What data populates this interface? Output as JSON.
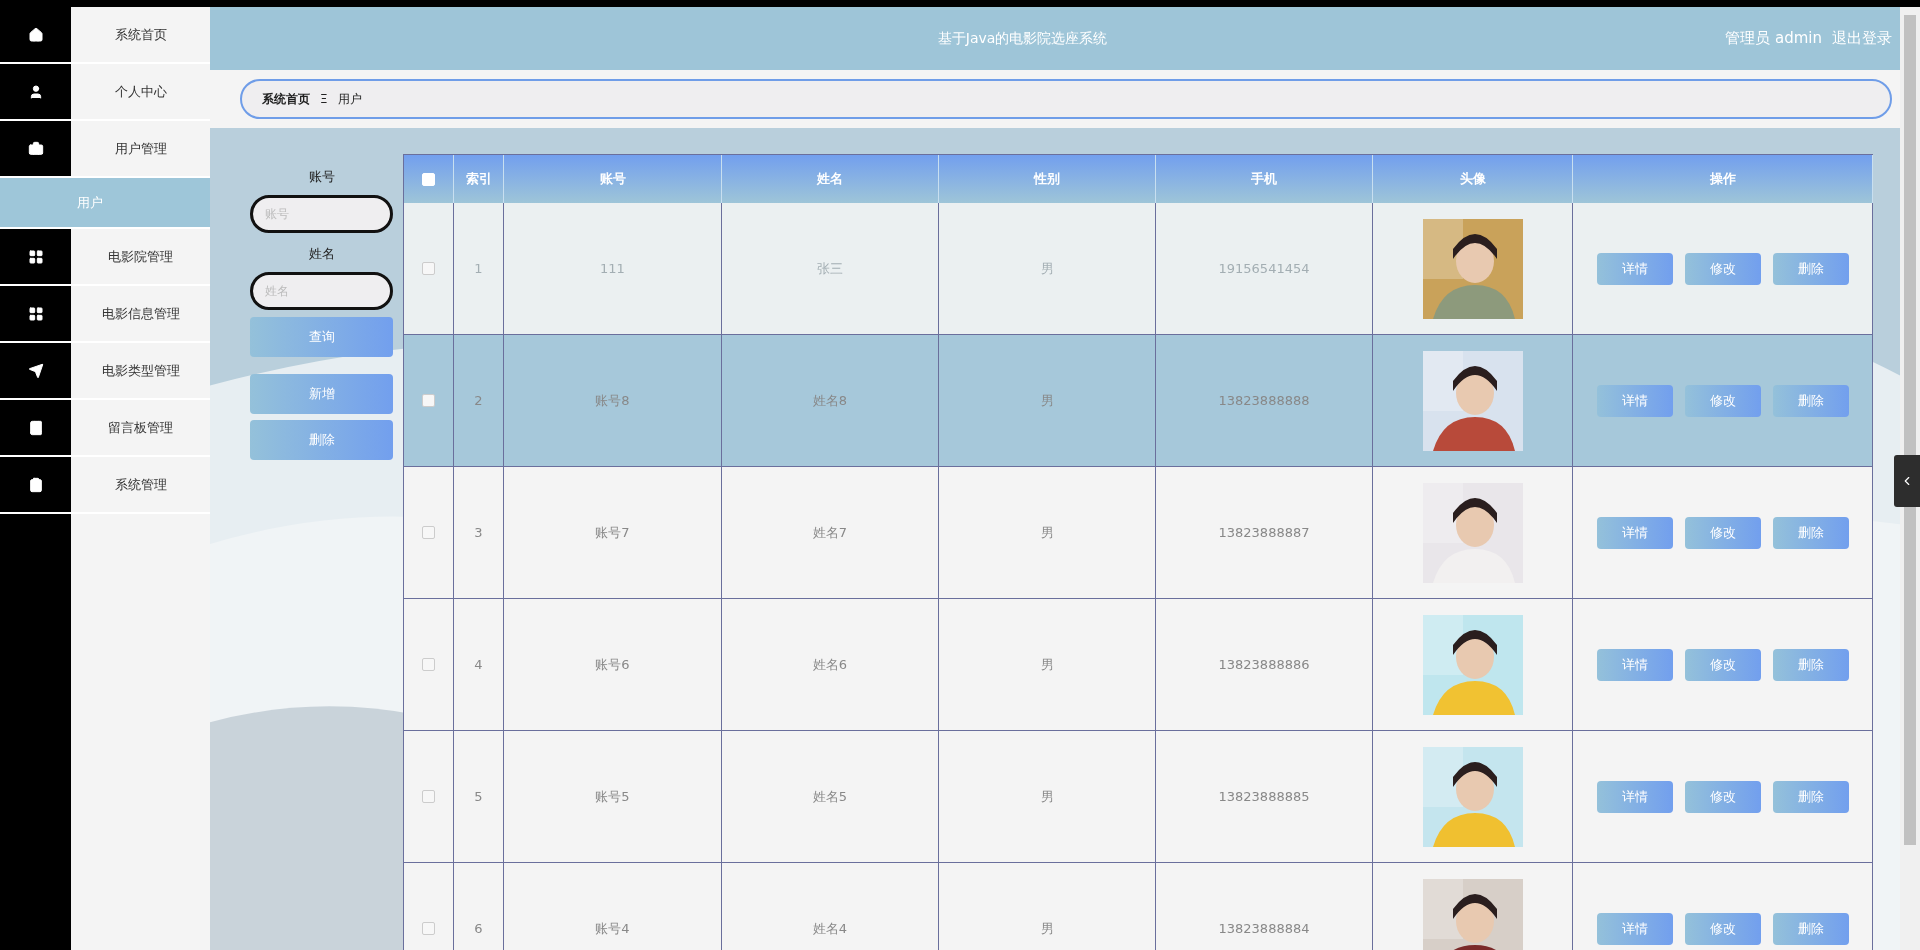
{
  "sidebar": {
    "items": [
      {
        "label": "系统首页",
        "selected": false
      },
      {
        "label": "个人中心",
        "selected": false
      },
      {
        "label": "用户管理",
        "selected": false,
        "expanded": true,
        "children": [
          {
            "label": "用户",
            "selected": true
          }
        ]
      },
      {
        "label": "电影院管理",
        "selected": false
      },
      {
        "label": "电影信息管理",
        "selected": false
      },
      {
        "label": "电影类型管理",
        "selected": false
      },
      {
        "label": "留言板管理",
        "selected": false
      },
      {
        "label": "系统管理",
        "selected": false
      }
    ]
  },
  "header": {
    "title": "基于Java的电影院选座系统",
    "user": "管理员 admin",
    "logout": "退出登录"
  },
  "breadcrumb": {
    "items": [
      "系统首页",
      "用户"
    ],
    "separator": "Ξ"
  },
  "search": {
    "fields": [
      {
        "label": "账号",
        "placeholder": "账号"
      },
      {
        "label": "姓名",
        "placeholder": "姓名"
      }
    ],
    "query_button": "查询",
    "buttons": [
      "新增",
      "删除"
    ]
  },
  "table": {
    "select_all": {
      "checked": false
    },
    "columns": [
      "索引",
      "账号",
      "姓名",
      "性别",
      "手机",
      "头像",
      "操作"
    ],
    "rows": [
      {
        "checked": false,
        "highlighted": false,
        "faded": true,
        "cells": [
          "1",
          "111",
          "张三",
          "男",
          "19156541454"
        ],
        "avatar": {
          "kind": "picture"
        },
        "actions": [
          "详情",
          "修改",
          "删除"
        ]
      },
      {
        "checked": false,
        "highlighted": true,
        "faded": false,
        "cells": [
          "2",
          "账号8",
          "姓名8",
          "男",
          "13823888888"
        ],
        "avatar": {
          "kind": "picture"
        },
        "actions": [
          "详情",
          "修改",
          "删除"
        ]
      },
      {
        "checked": false,
        "highlighted": false,
        "faded": false,
        "cells": [
          "3",
          "账号7",
          "姓名7",
          "男",
          "13823888887"
        ],
        "avatar": {
          "kind": "picture"
        },
        "actions": [
          "详情",
          "修改",
          "删除"
        ]
      },
      {
        "checked": false,
        "highlighted": false,
        "faded": false,
        "cells": [
          "4",
          "账号6",
          "姓名6",
          "男",
          "13823888886"
        ],
        "avatar": {
          "kind": "picture"
        },
        "actions": [
          "详情",
          "修改",
          "删除"
        ]
      },
      {
        "checked": false,
        "highlighted": false,
        "faded": false,
        "cells": [
          "5",
          "账号5",
          "姓名5",
          "男",
          "13823888885"
        ],
        "avatar": {
          "kind": "picture"
        },
        "actions": [
          "详情",
          "修改",
          "删除"
        ]
      },
      {
        "checked": false,
        "highlighted": false,
        "faded": false,
        "cells": [
          "6",
          "账号4",
          "姓名4",
          "男",
          "13823888884"
        ],
        "avatar": {
          "kind": "picture"
        },
        "actions": [
          "详情",
          "修改",
          "删除"
        ]
      }
    ]
  }
}
